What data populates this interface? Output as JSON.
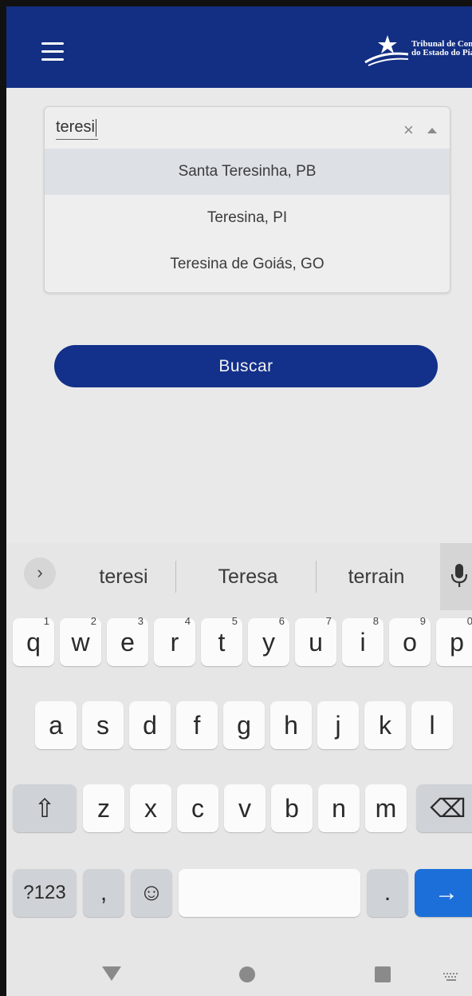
{
  "header": {
    "menu_icon": "hamburger-menu-icon",
    "logo_line1": "Tribunal de Contas",
    "logo_line2": "do Estado do Piauí",
    "color": "#132f83"
  },
  "search": {
    "value": "teresi",
    "clear_icon": "×",
    "options": [
      "Santa Teresinha, PB",
      "Teresina, PI",
      "Teresina de Goiás, GO"
    ]
  },
  "buscar_label": "Buscar",
  "keyboard": {
    "suggestions": [
      "teresi",
      "Teresa",
      "terrain"
    ],
    "expand_glyph": "›",
    "row1": [
      {
        "k": "q",
        "h": "1"
      },
      {
        "k": "w",
        "h": "2"
      },
      {
        "k": "e",
        "h": "3"
      },
      {
        "k": "r",
        "h": "4"
      },
      {
        "k": "t",
        "h": "5"
      },
      {
        "k": "y",
        "h": "6"
      },
      {
        "k": "u",
        "h": "7"
      },
      {
        "k": "i",
        "h": "8"
      },
      {
        "k": "o",
        "h": "9"
      },
      {
        "k": "p",
        "h": "0"
      }
    ],
    "row2": [
      "a",
      "s",
      "d",
      "f",
      "g",
      "h",
      "j",
      "k",
      "l"
    ],
    "row3": [
      "z",
      "x",
      "c",
      "v",
      "b",
      "n",
      "m"
    ],
    "shift_glyph": "⇧",
    "backspace_glyph": "⌫",
    "symbols_label": "?123",
    "comma": ",",
    "emoji_glyph": "☺",
    "period": ".",
    "enter_glyph": "→",
    "enter_color": "#1c6fd8"
  }
}
